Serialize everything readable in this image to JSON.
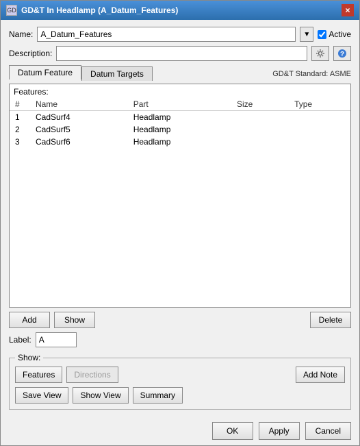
{
  "window": {
    "title": "GD&T In Headlamp (A_Datum_Features)",
    "close_label": "×"
  },
  "form": {
    "name_label": "Name:",
    "name_value": "A_Datum_Features",
    "active_label": "Active",
    "active_checked": true,
    "description_label": "Description:",
    "description_value": "",
    "gdt_standard": "GD&T Standard: ASME"
  },
  "tabs": [
    {
      "label": "Datum Feature",
      "active": true
    },
    {
      "label": "Datum Targets",
      "active": false
    }
  ],
  "features": {
    "section_label": "Features:",
    "columns": [
      "#",
      "Name",
      "Part",
      "Size",
      "Type"
    ],
    "rows": [
      {
        "num": "1",
        "name": "CadSurf4",
        "part": "Headlamp",
        "size": "",
        "type": ""
      },
      {
        "num": "2",
        "name": "CadSurf5",
        "part": "Headlamp",
        "size": "",
        "type": ""
      },
      {
        "num": "3",
        "name": "CadSurf6",
        "part": "Headlamp",
        "size": "",
        "type": ""
      }
    ]
  },
  "buttons": {
    "add": "Add",
    "show": "Show",
    "delete": "Delete"
  },
  "label_field": {
    "label": "Label:",
    "value": "A"
  },
  "show_group": {
    "title": "Show:",
    "features_btn": "Features",
    "directions_btn": "Directions",
    "add_note_btn": "Add Note",
    "save_view_btn": "Save View",
    "show_view_btn": "Show View",
    "summary_btn": "Summary"
  },
  "footer": {
    "ok": "OK",
    "apply": "Apply",
    "cancel": "Cancel"
  }
}
